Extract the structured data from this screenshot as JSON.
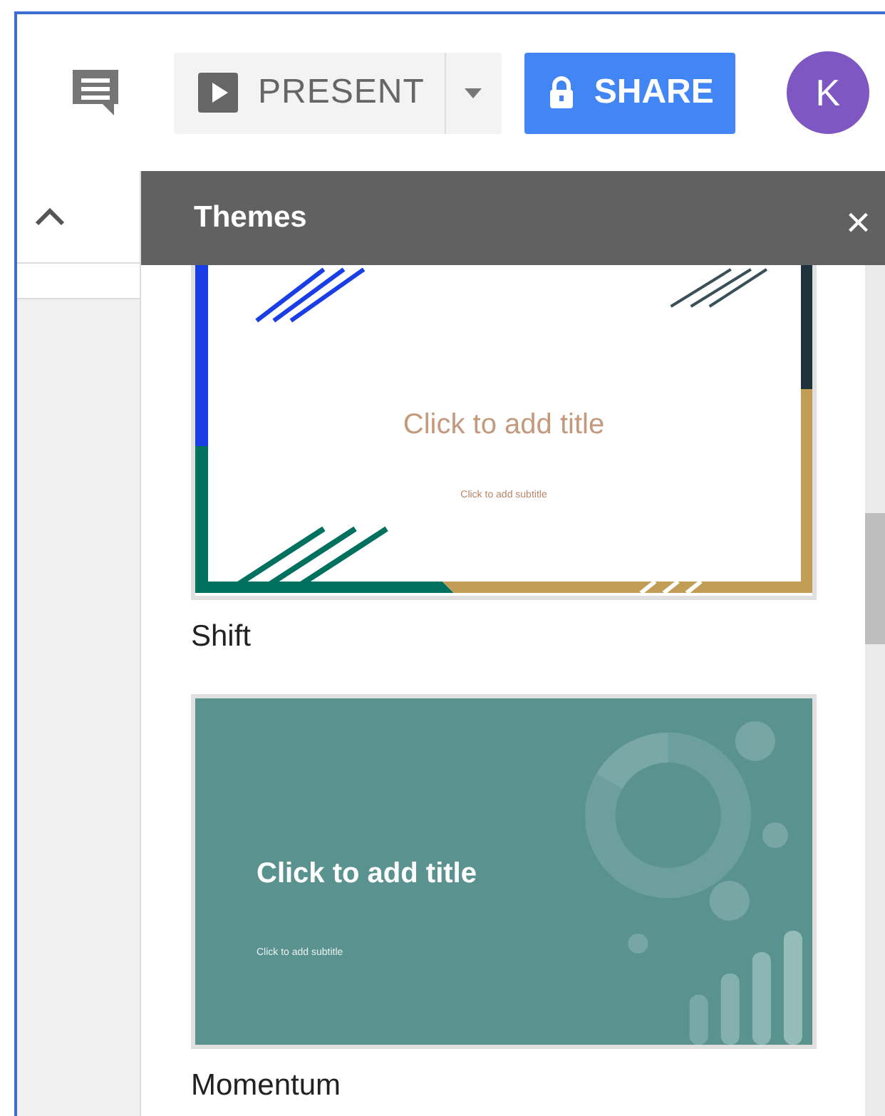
{
  "toolbar": {
    "present_label": "PRESENT",
    "share_label": "SHARE",
    "avatar_initial": "K"
  },
  "panel": {
    "title": "Themes",
    "close": "×"
  },
  "themes": [
    {
      "name": "Shift",
      "kind": "shift",
      "title": "Click to add title",
      "subtitle": "Click to add subtitle"
    },
    {
      "name": "Momentum",
      "kind": "momentum",
      "title": "Click to add title",
      "subtitle": "Click to add subtitle"
    }
  ]
}
